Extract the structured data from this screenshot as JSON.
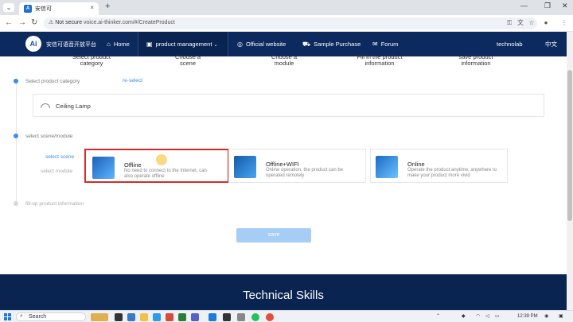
{
  "browser": {
    "tab_title": "安信可",
    "tab_close": "×",
    "new_tab": "+",
    "not_secure": "Not secure",
    "url": "voice.ai-thinker.com/#/CreateProduct"
  },
  "site_nav": {
    "logo": "Ai",
    "brand": "安信可语音开放平台",
    "home": "Home",
    "product_management": "product management",
    "official_website": "Official website",
    "sample_purchase": "Sample Purchase",
    "forum": "Forum",
    "user": "technolab",
    "language": "中文"
  },
  "steps": [
    {
      "line1": "Select product",
      "line2": "category"
    },
    {
      "line1": "Choose a",
      "line2": "scene"
    },
    {
      "line1": "Choose a",
      "line2": "module"
    },
    {
      "line1": "Fill in the product",
      "line2": "information"
    },
    {
      "line1": "save product",
      "line2": "information"
    }
  ],
  "sections": {
    "category_title": "Select product category",
    "reselect": "re-select",
    "selected_category": "Ceiling Lamp",
    "scene_module_title": "select scene/module",
    "select_scene": "select scene",
    "select_module": "select module",
    "fill_info_title": "fill-up product information"
  },
  "scenes": [
    {
      "title": "Offline",
      "desc": "No need to connect to the Internet, can also operate offline"
    },
    {
      "title": "Offline+WIFI",
      "desc": "Online operation, the product can be operated remotely"
    },
    {
      "title": "Online",
      "desc": "Operate the product anytime, anywhere to make your product more vivid"
    }
  ],
  "save_label": "save",
  "footer_title": "Technical Skills",
  "taskbar": {
    "search_label": "Search",
    "time": "12:39 PM"
  },
  "colors": {
    "nav_bg": "#0d2a5e",
    "accent": "#3a8ee6",
    "selection_outline": "#d82a2a",
    "save_disabled": "#a6cdf5"
  }
}
